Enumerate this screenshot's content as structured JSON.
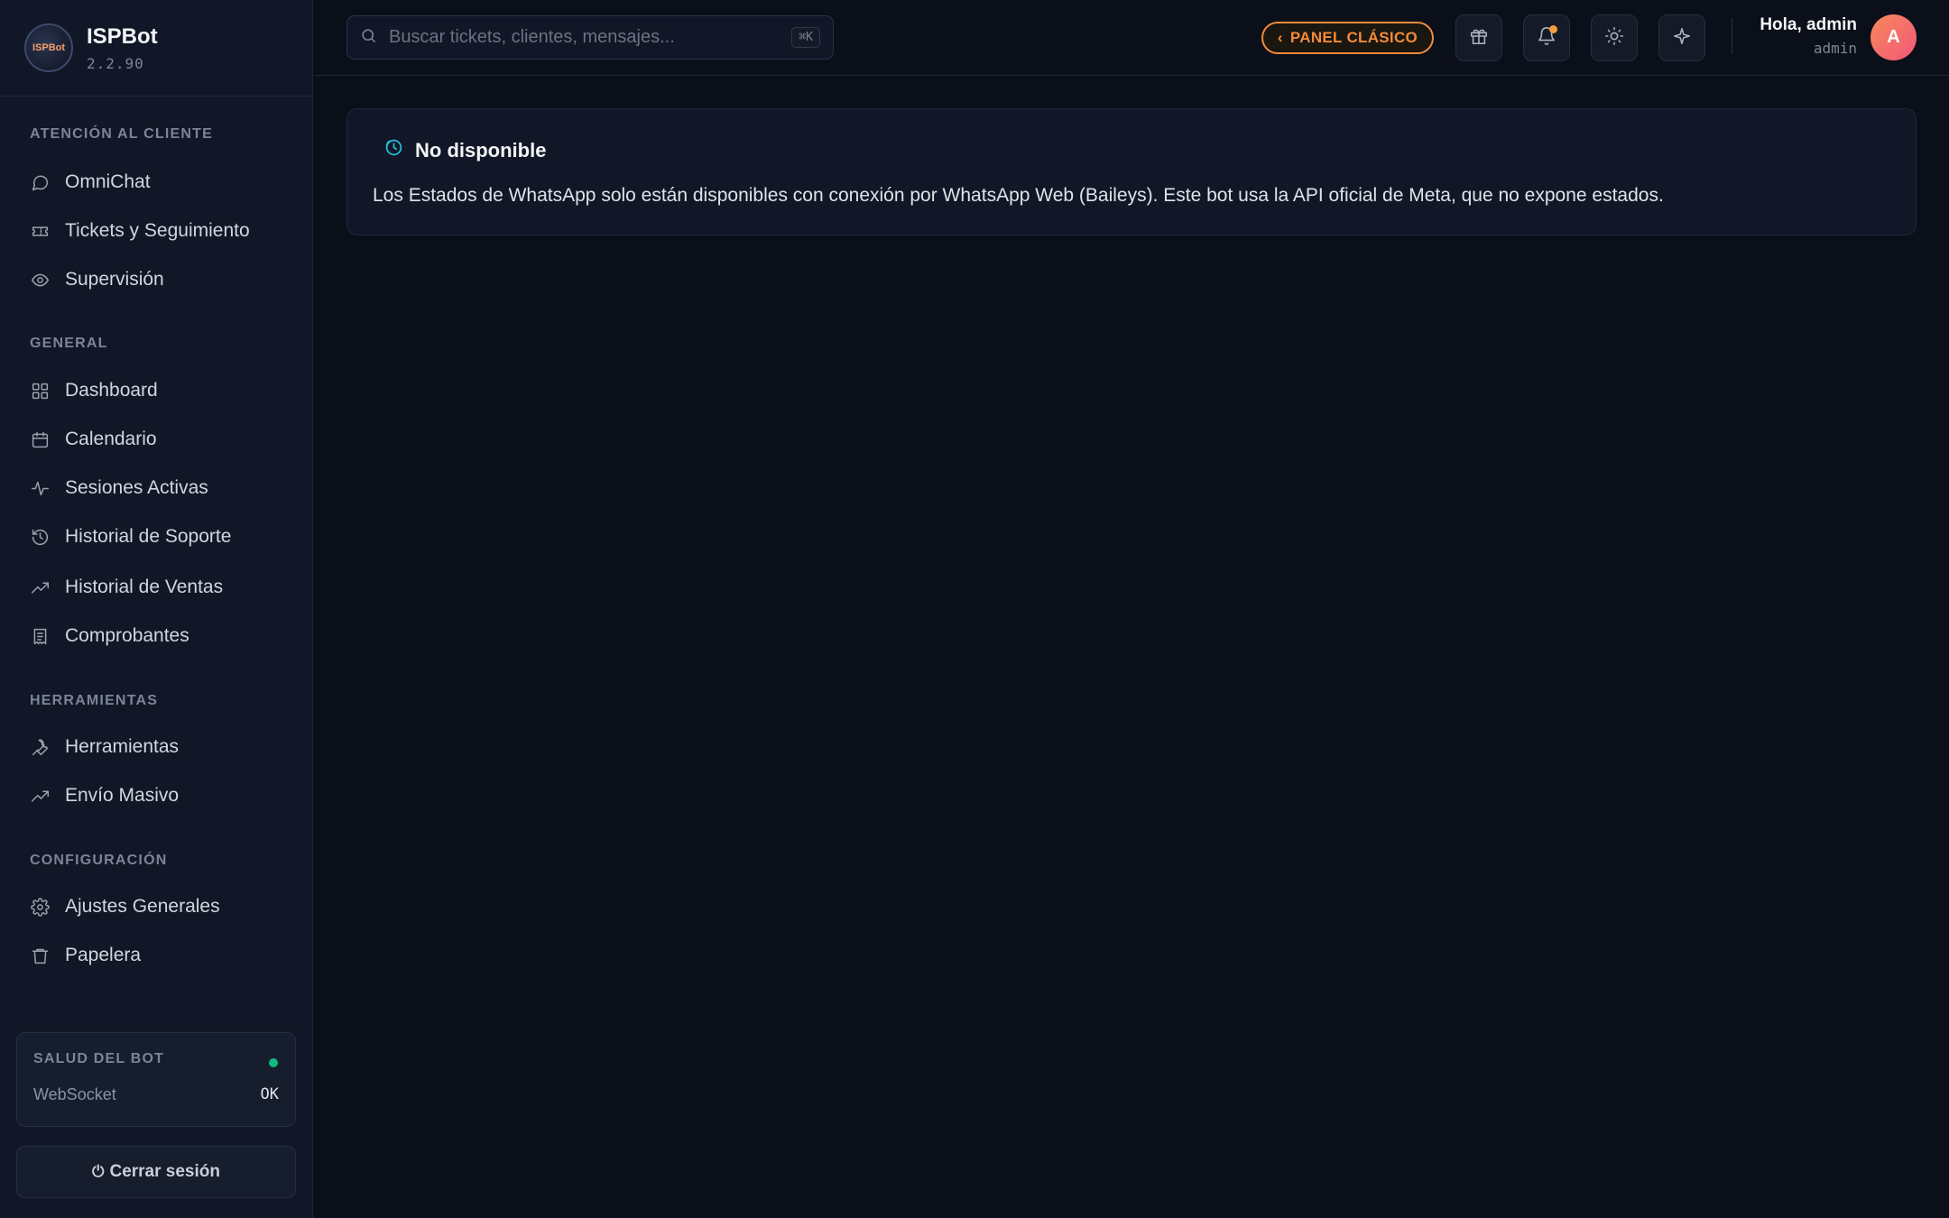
{
  "brand": {
    "name": "ISPBot",
    "version": "2.2.90",
    "logo_text": "ISPBot"
  },
  "sidebar": {
    "sections": [
      {
        "title": "ATENCIÓN AL CLIENTE",
        "items": [
          {
            "label": "OmniChat",
            "icon": "chat-bubble-icon"
          },
          {
            "label": "Tickets y Seguimiento",
            "icon": "ticket-icon"
          },
          {
            "label": "Supervisión",
            "icon": "eye-icon"
          }
        ]
      },
      {
        "title": "GENERAL",
        "items": [
          {
            "label": "Dashboard",
            "icon": "grid-icon"
          },
          {
            "label": "Calendario",
            "icon": "calendar-icon"
          },
          {
            "label": "Sesiones Activas",
            "icon": "activity-icon"
          },
          {
            "label": "Historial de Soporte",
            "icon": "history-icon"
          },
          {
            "label": "Historial de Ventas",
            "icon": "trending-up-icon"
          },
          {
            "label": "Comprobantes",
            "icon": "receipt-icon"
          }
        ]
      },
      {
        "title": "HERRAMIENTAS",
        "items": [
          {
            "label": "Herramientas",
            "icon": "wrench-icon"
          },
          {
            "label": "Envío Masivo",
            "icon": "trending-up-icon"
          }
        ]
      },
      {
        "title": "CONFIGURACIÓN",
        "items": [
          {
            "label": "Ajustes Generales",
            "icon": "gear-icon"
          },
          {
            "label": "Papelera",
            "icon": "trash-icon"
          }
        ]
      }
    ],
    "health": {
      "title": "SALUD DEL BOT",
      "status_color": "#10b981",
      "row_label": "WebSocket",
      "row_value": "OK"
    },
    "logout_label": "Cerrar sesión"
  },
  "topbar": {
    "search_placeholder": "Buscar tickets, clientes, mensajes...",
    "search_value": "",
    "search_shortcut": "⌘K",
    "classic_label": "PANEL CLÁSICO",
    "accent_color": "#f28b3a",
    "icons": [
      "gift-icon",
      "bell-icon",
      "sun-icon",
      "sparkle-icon"
    ],
    "greeting": "Hola, admin",
    "role": "admin",
    "avatar_initial": "A"
  },
  "main": {
    "card_title": "No disponible",
    "card_text": "Los Estados de WhatsApp solo están disponibles con conexión por WhatsApp Web (Baileys). Este bot usa la API oficial de Meta, que no expone estados."
  }
}
